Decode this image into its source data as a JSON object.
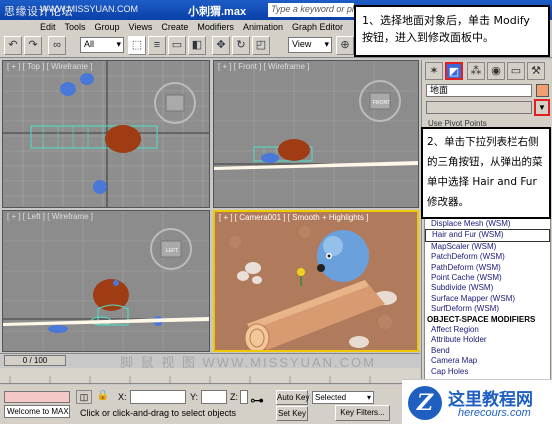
{
  "watermark_top": "思缘设计论坛",
  "watermark_url": "WWW.MISSYUAN.COM",
  "window": {
    "file_name": "小刺猬.max",
    "help_placeholder": "Type a keyword or phrase"
  },
  "menu": [
    "Edit",
    "Tools",
    "Group",
    "Views",
    "Create",
    "Modifiers",
    "Animation",
    "Graph Editor"
  ],
  "toolbar": {
    "selection_filter": "All",
    "ref_coord": "View"
  },
  "viewports": {
    "top_label": "[ + ] [ Top ] [ Wireframe ]",
    "front_label": "[ + ] [ Front ] [ Wireframe ]",
    "left_label": "[ + ] [ Left ] [ Wireframe ]",
    "camera_label": "[ + ] [ Camera001 ] [ Smooth + Highlights ]",
    "front_cube": "FRONT",
    "left_cube": "LEFT"
  },
  "command_panel": {
    "object_name": "地面",
    "partial_top": "Use Pivot Points",
    "modifier_list": [
      {
        "label": "Displace Mesh (WSM)",
        "kind": "item"
      },
      {
        "label": "Hair and Fur (WSM)",
        "kind": "selected"
      },
      {
        "label": "MapScaler (WSM)",
        "kind": "item"
      },
      {
        "label": "PatchDeform (WSM)",
        "kind": "item"
      },
      {
        "label": "PathDeform (WSM)",
        "kind": "item"
      },
      {
        "label": "Point Cache (WSM)",
        "kind": "item"
      },
      {
        "label": "Subdivide (WSM)",
        "kind": "item"
      },
      {
        "label": "Surface Mapper (WSM)",
        "kind": "item"
      },
      {
        "label": "SurfDeform (WSM)",
        "kind": "item"
      },
      {
        "label": "OBJECT-SPACE MODIFIERS",
        "kind": "header"
      },
      {
        "label": "Affect Region",
        "kind": "item"
      },
      {
        "label": "Attribute Holder",
        "kind": "item"
      },
      {
        "label": "Bend",
        "kind": "item"
      },
      {
        "label": "Camera Map",
        "kind": "item"
      },
      {
        "label": "Cap Holes",
        "kind": "item"
      }
    ]
  },
  "callouts": {
    "step1": "1、选择地面对象后，单击 Modify 按钮，进入到修改面板中。",
    "step2": "2、单击下拉列表栏右侧的三角按钮，从弹出的菜单中选择 Hair and Fur 修改器。"
  },
  "timeline": {
    "frame": "0 / 100",
    "watermark": "脚 鼠 视 图 WWW.MISSYUAN.COM"
  },
  "status": {
    "welcome": "Welcome to MAX",
    "prompt": "Click or click-and-drag to select objects",
    "x_label": "X:",
    "y_label": "Y:",
    "z_label": "Z:",
    "auto_key": "Auto Key",
    "set_key": "Set Key",
    "selected": "Selected",
    "key_filters": "Key Filters..."
  },
  "logo": {
    "name": "这里教程网",
    "url": "herecours.com"
  },
  "colors": {
    "title_bar": "#0a3fa8",
    "callout_border": "#e02020",
    "camera_frame": "#f0c800",
    "logo_blue": "#1e5fc0"
  }
}
